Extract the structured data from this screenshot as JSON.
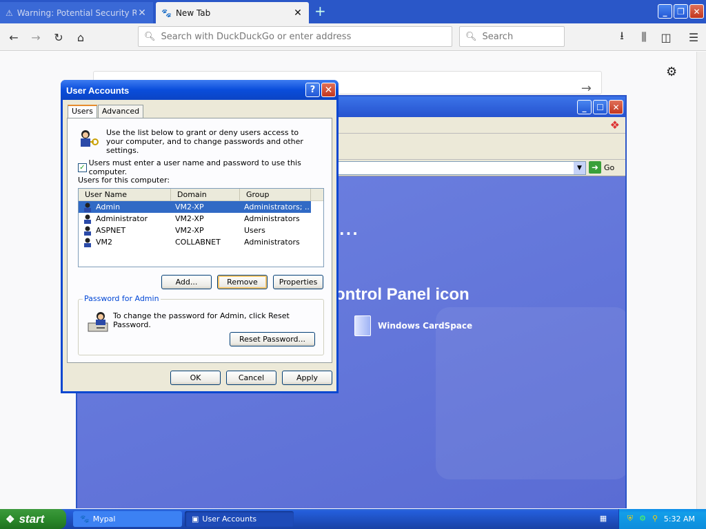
{
  "browser": {
    "tabs": [
      {
        "label": "Warning: Potential Security Risk Ah",
        "icon": "warning-icon"
      },
      {
        "label": "New Tab",
        "icon": "page-icon"
      }
    ],
    "url_placeholder": "Search with DuckDuckGo or enter address",
    "search_placeholder": "Search"
  },
  "control_panel": {
    "heading": "ontrol Panel icon",
    "dots": "...",
    "cardspace_label": "Windows CardSpace",
    "go_label": "Go"
  },
  "user_accounts": {
    "title": "User Accounts",
    "tabs": [
      "Users",
      "Advanced"
    ],
    "intro": "Use the list below to grant or deny users access to your computer, and to change passwords and other settings.",
    "require_login_label": "Users must enter a user name and password to use this computer.",
    "require_login_checked": true,
    "users_label": "Users for this computer:",
    "columns": [
      "User Name",
      "Domain",
      "Group"
    ],
    "users": [
      {
        "name": "Admin",
        "domain": "VM2-XP",
        "group": "Administrators; ...",
        "selected": true
      },
      {
        "name": "Administrator",
        "domain": "VM2-XP",
        "group": "Administrators",
        "selected": false
      },
      {
        "name": "ASPNET",
        "domain": "VM2-XP",
        "group": "Users",
        "selected": false
      },
      {
        "name": "VM2",
        "domain": "COLLABNET",
        "group": "Administrators",
        "selected": false
      }
    ],
    "buttons": {
      "add": "Add...",
      "remove": "Remove",
      "properties": "Properties"
    },
    "password_group_label": "Password for Admin",
    "password_text": "To change the password for Admin, click Reset Password.",
    "reset_password": "Reset Password...",
    "ok": "OK",
    "cancel": "Cancel",
    "apply": "Apply"
  },
  "taskbar": {
    "start": "start",
    "items": [
      {
        "label": "Mypal"
      },
      {
        "label": "User Accounts"
      }
    ],
    "clock": "5:32 AM"
  }
}
